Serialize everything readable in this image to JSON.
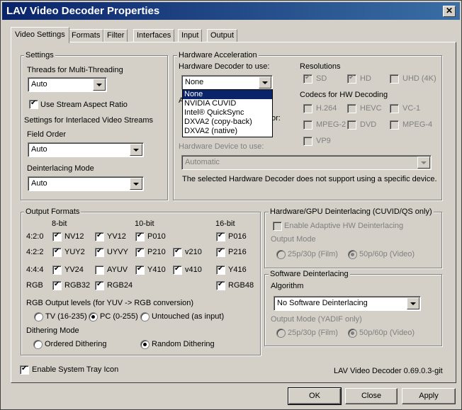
{
  "window": {
    "title": "LAV Video Decoder Properties",
    "close_glyph": "✕"
  },
  "tabs": [
    "Video Settings",
    "Formats",
    "Filter",
    "Interfaces",
    "Input",
    "Output"
  ],
  "settings": {
    "group_title": "Settings",
    "threads_label": "Threads for Multi-Threading",
    "threads_value": "Auto",
    "stream_aspect_label": "Use Stream Aspect Ratio",
    "interlaced_label": "Settings for Interlaced Video Streams",
    "field_order_label": "Field Order",
    "field_order_value": "Auto",
    "deint_mode_label": "Deinterlacing Mode",
    "deint_mode_value": "Auto"
  },
  "hwaccel": {
    "group_title": "Hardware Acceleration",
    "decoder_label": "Hardware Decoder to use:",
    "decoder_value": "None",
    "decoder_options": [
      "None",
      "NVIDIA CUVID",
      "Intel® QuickSync",
      "DXVA2 (copy-back)",
      "DXVA2 (native)"
    ],
    "hidden_label_a": "A",
    "hidden_label_b": "or:",
    "device_label": "Hardware Device to use:",
    "device_value": "Automatic",
    "device_note": "The selected Hardware Decoder does not support using a specific device.",
    "resolutions_label": "Resolutions",
    "resolutions": [
      {
        "label": "SD",
        "checked": true
      },
      {
        "label": "HD",
        "checked": true
      },
      {
        "label": "UHD (4K)",
        "checked": false
      }
    ],
    "codecs_label": "Codecs for HW Decoding",
    "codecs": [
      "H.264",
      "HEVC",
      "VC-1",
      "MPEG-2",
      "DVD",
      "MPEG-4",
      "VP9"
    ]
  },
  "output_formats": {
    "group_title": "Output Formats",
    "col_headers": [
      "8-bit",
      "10-bit",
      "16-bit"
    ],
    "row_labels": [
      "4:2:0",
      "4:2:2",
      "4:4:4",
      "RGB"
    ],
    "formats": [
      {
        "label": "NV12",
        "checked": true
      },
      {
        "label": "YV12",
        "checked": true
      },
      {
        "label": "P010",
        "checked": true
      },
      {
        "label": "P016",
        "checked": true
      },
      {
        "label": "YUY2",
        "checked": true
      },
      {
        "label": "UYVY",
        "checked": true
      },
      {
        "label": "P210",
        "checked": true
      },
      {
        "label": "v210",
        "checked": true
      },
      {
        "label": "P216",
        "checked": true
      },
      {
        "label": "YV24",
        "checked": true
      },
      {
        "label": "AYUV",
        "checked": false
      },
      {
        "label": "Y410",
        "checked": true
      },
      {
        "label": "v410",
        "checked": true
      },
      {
        "label": "Y416",
        "checked": true
      },
      {
        "label": "RGB32",
        "checked": true
      },
      {
        "label": "RGB24",
        "checked": true
      },
      {
        "label": "RGB48",
        "checked": true
      }
    ],
    "rgb_levels_label": "RGB Output levels (for YUV -> RGB conversion)",
    "rgb_levels": [
      "TV (16-235)",
      "PC (0-255)",
      "Untouched (as input)"
    ],
    "rgb_levels_selected": "PC (0-255)",
    "dithering_label": "Dithering Mode",
    "dithering": [
      "Ordered Dithering",
      "Random Dithering"
    ],
    "dithering_selected": "Random Dithering"
  },
  "hw_deint": {
    "group_title": "Hardware/GPU Deinterlacing (CUVID/QS only)",
    "adaptive_label": "Enable Adaptive HW Deinterlacing",
    "output_mode_label": "Output Mode",
    "modes": [
      "25p/30p (Film)",
      "50p/60p (Video)"
    ],
    "mode_selected": "50p/60p (Video)"
  },
  "sw_deint": {
    "group_title": "Software Deinterlacing",
    "algorithm_label": "Algorithm",
    "algorithm_value": "No Software Deinterlacing",
    "output_mode_label": "Output Mode (YADIF only)",
    "modes": [
      "25p/30p (Film)",
      "50p/60p (Video)"
    ],
    "mode_selected": "50p/60p (Video)"
  },
  "tray_icon_label": "Enable System Tray Icon",
  "version": "LAV Video Decoder 0.69.0.3-git",
  "buttons": {
    "ok": "OK",
    "close": "Close",
    "apply": "Apply"
  }
}
